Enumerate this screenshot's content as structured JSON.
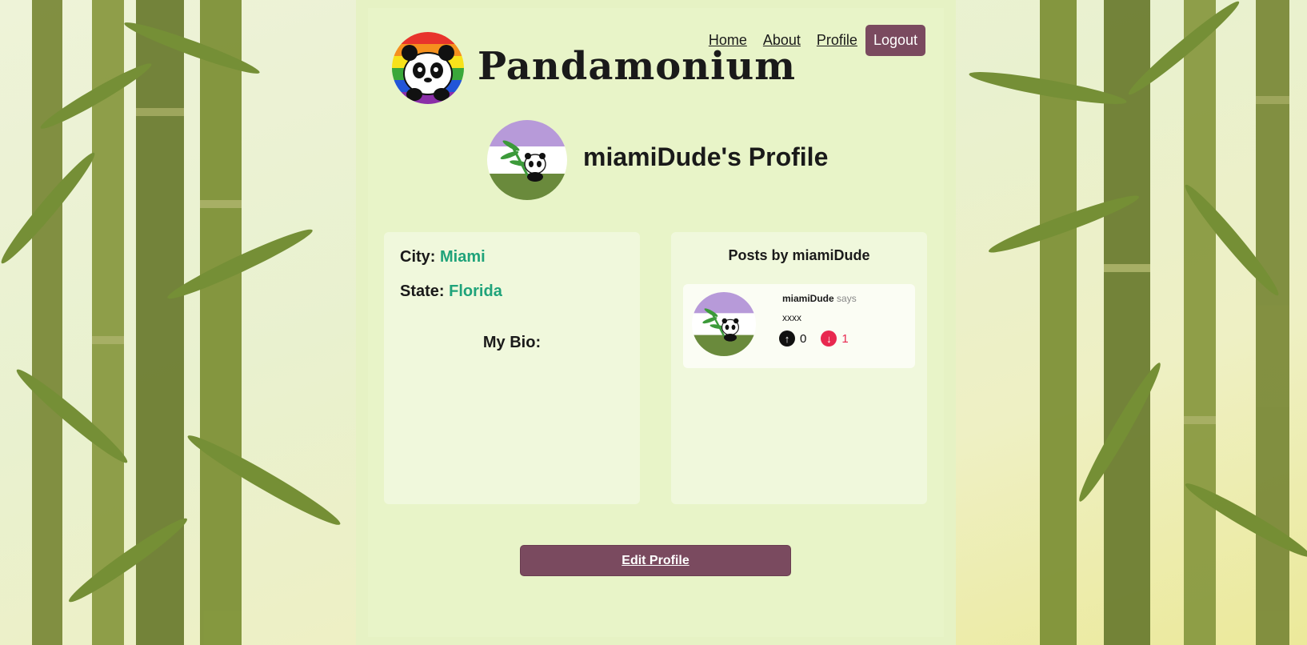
{
  "header": {
    "brand": "Pandamonium",
    "logo_icon": "rainbow-panda-icon"
  },
  "nav": {
    "home": "Home",
    "about": "About",
    "profile": "Profile",
    "logout": "Logout"
  },
  "profile": {
    "title": "miamiDude's Profile",
    "avatar_icon": "panda-bamboo-avatar-icon",
    "city_label": "City:",
    "city": "Miami",
    "state_label": "State:",
    "state": "Florida",
    "bio_label": "My Bio:"
  },
  "posts": {
    "title": "Posts by miamiDude",
    "items": [
      {
        "author": "miamiDude",
        "says": "says",
        "body": "xxxx",
        "upvotes": "0",
        "downvotes": "1"
      }
    ]
  },
  "actions": {
    "edit_profile": "Edit Profile"
  },
  "colors": {
    "accent": "#7a4a5f",
    "value_green": "#1fa37a",
    "downvote_red": "#e8284f",
    "page_bg": "#e8f4c8"
  }
}
